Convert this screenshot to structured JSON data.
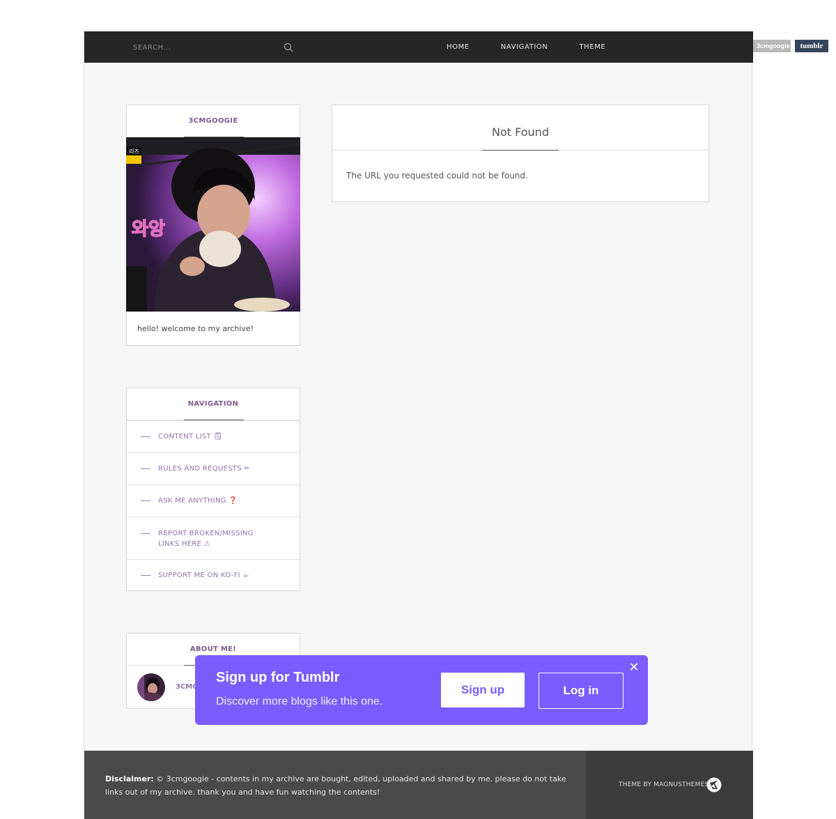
{
  "tumblr_bar": {
    "username": "3cmgoogie",
    "logo_text": "tumblr"
  },
  "topbar": {
    "search_placeholder": "SEARCH...",
    "nav": [
      "HOME",
      "NAVIGATION",
      "THEME"
    ]
  },
  "profile": {
    "title": "3CMGOOGIE",
    "description": "hello! welcome to my archive!",
    "image_overlay_text": "와앙",
    "image_corner_text": "리즈"
  },
  "navigation": {
    "title": "NAVIGATION",
    "items": [
      {
        "label": "CONTENT LIST 🗒"
      },
      {
        "label": "RULES AND REQUESTS ✏"
      },
      {
        "label": "ASK ME ANYTHING ❓"
      },
      {
        "label": "REPORT BROKEN/MISSING LINKS HERE ⚠"
      },
      {
        "label": "SUPPORT ME ON KO-FI ☕"
      }
    ]
  },
  "about": {
    "title": "ABOUT ME!",
    "name": "3CMG"
  },
  "content": {
    "title": "Not Found",
    "message": "The URL you requested could not be found."
  },
  "footer": {
    "disclaimer_label": "Disclaimer:",
    "disclaimer_text": " © 3cmgoogie - contents in my archive are bought, edited, uploaded and shared by me. please do not take links out of my archive. thank you and have fun watching the contents!",
    "credit": "THEME BY MAGNUSTHEMES"
  },
  "signup_popup": {
    "title": "Sign up for Tumblr",
    "subtitle": "Discover more blogs like this one.",
    "signup_label": "Sign up",
    "login_label": "Log in",
    "close_glyph": "✕"
  },
  "colors": {
    "accent": "#8e74a8",
    "topbar": "#262626",
    "popup": "#7b5cff",
    "footer": "#4a4a4a"
  }
}
